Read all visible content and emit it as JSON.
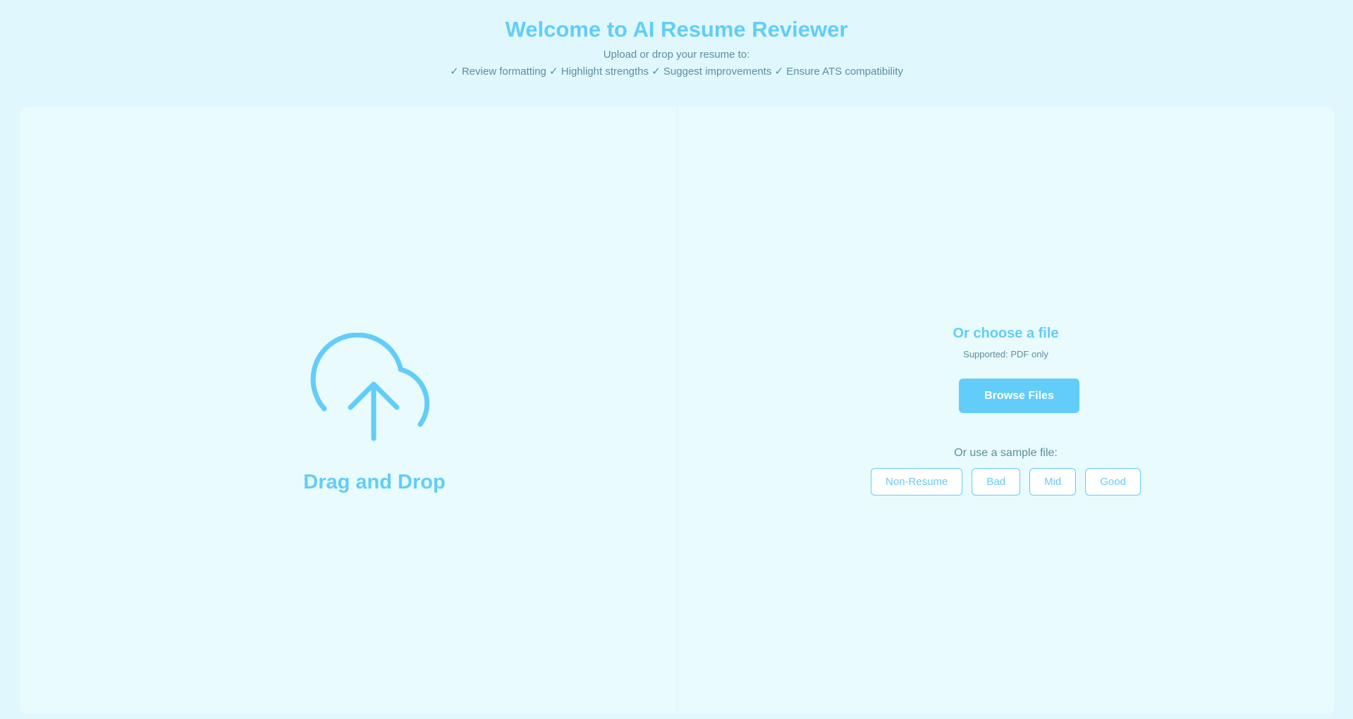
{
  "header": {
    "title": "Welcome to AI Resume Reviewer",
    "subtitle": "Upload or drop your resume to:",
    "features": "✓ Review formatting ✓ Highlight strengths ✓ Suggest improvements ✓ Ensure ATS compatibility"
  },
  "dropzone": {
    "icon": "cloud-upload-icon",
    "label": "Drag and Drop"
  },
  "chooser": {
    "title": "Or choose a file",
    "supported": "Supported: PDF only",
    "browse_label": "Browse Files",
    "sample_label": "Or use a sample file:",
    "samples": [
      {
        "label": "Non-Resume"
      },
      {
        "label": "Bad"
      },
      {
        "label": "Mid"
      },
      {
        "label": "Good"
      }
    ]
  },
  "colors": {
    "accent": "#62cdf8",
    "page_background": "#e0f7fd",
    "card_background": "#e9fbfd",
    "muted_text": "#5a8f9f"
  }
}
